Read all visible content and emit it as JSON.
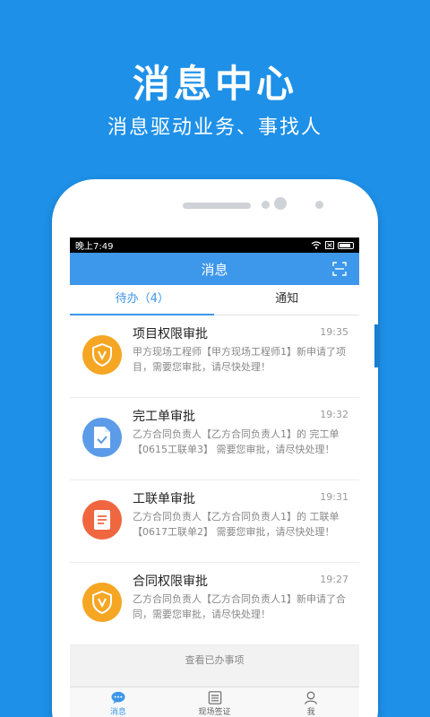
{
  "promo": {
    "title": "消息中心",
    "subtitle": "消息驱动业务、事找人"
  },
  "statusbar": {
    "time": "晚上7:49"
  },
  "navbar": {
    "title": "消息",
    "scan_icon": "scan-icon"
  },
  "tabs": [
    {
      "label": "待办（4）",
      "active": true
    },
    {
      "label": "通知",
      "active": false
    }
  ],
  "messages": [
    {
      "title": "项目权限审批",
      "time": "19:35",
      "desc": "甲方现场工程师【甲方现场工程师1】新申请了项目，需要您审批，请尽快处理！",
      "icon": "shield-v-icon",
      "color": "#f5a623"
    },
    {
      "title": "完工单审批",
      "time": "19:32",
      "desc": "乙方合同负责人【乙方合同负责人1】的 完工单 【0615工联单3】 需要您审批，请尽快处理！",
      "icon": "document-check-icon",
      "color": "#5b9be8"
    },
    {
      "title": "工联单审批",
      "time": "19:31",
      "desc": "乙方合同负责人【乙方合同负责人1】的 工联单 【0617工联单2】 需要您审批，请尽快处理！",
      "icon": "document-icon",
      "color": "#f0663f"
    },
    {
      "title": "合同权限审批",
      "time": "19:27",
      "desc": "乙方合同负责人【乙方合同负责人1】新申请了合同，需要您审批，请尽快处理！",
      "icon": "shield-v-icon",
      "color": "#f5a623"
    }
  ],
  "view_done": "查看已办事项",
  "bottom_nav": [
    {
      "label": "消息",
      "icon": "chat-icon",
      "active": true
    },
    {
      "label": "现场签证",
      "icon": "list-icon",
      "active": false
    },
    {
      "label": "我",
      "icon": "user-icon",
      "active": false
    }
  ],
  "colors": {
    "background": "#1e90e8",
    "navbar": "#3d97ea",
    "accent": "#3d97ea"
  }
}
